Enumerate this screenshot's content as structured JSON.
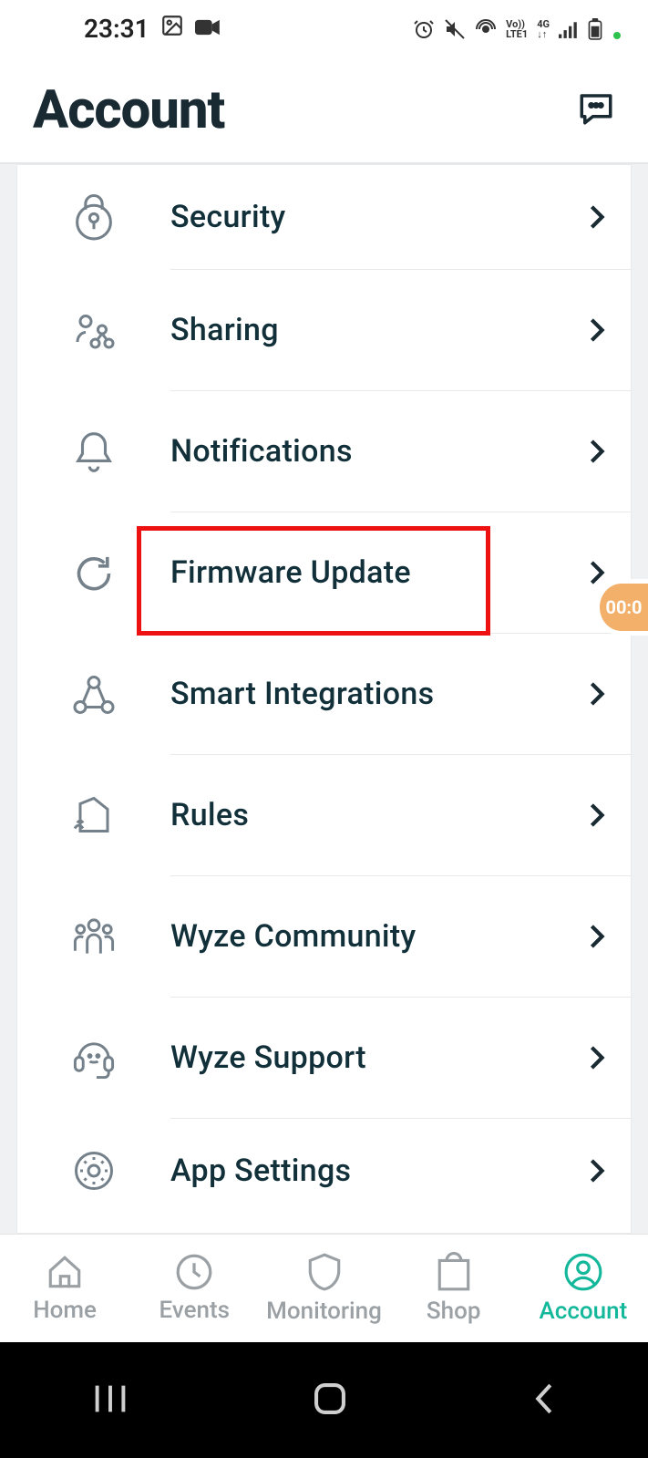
{
  "status": {
    "time": "23:31"
  },
  "header": {
    "title": "Account"
  },
  "menu": {
    "items": [
      {
        "label": "Security"
      },
      {
        "label": "Sharing"
      },
      {
        "label": "Notifications"
      },
      {
        "label": "Firmware Update"
      },
      {
        "label": "Smart Integrations"
      },
      {
        "label": "Rules"
      },
      {
        "label": "Wyze Community"
      },
      {
        "label": "Wyze Support"
      },
      {
        "label": "App Settings"
      }
    ]
  },
  "nav": {
    "items": [
      {
        "label": "Home"
      },
      {
        "label": "Events"
      },
      {
        "label": "Monitoring"
      },
      {
        "label": "Shop"
      },
      {
        "label": "Account"
      }
    ]
  },
  "floating": {
    "timer": "00:0"
  }
}
